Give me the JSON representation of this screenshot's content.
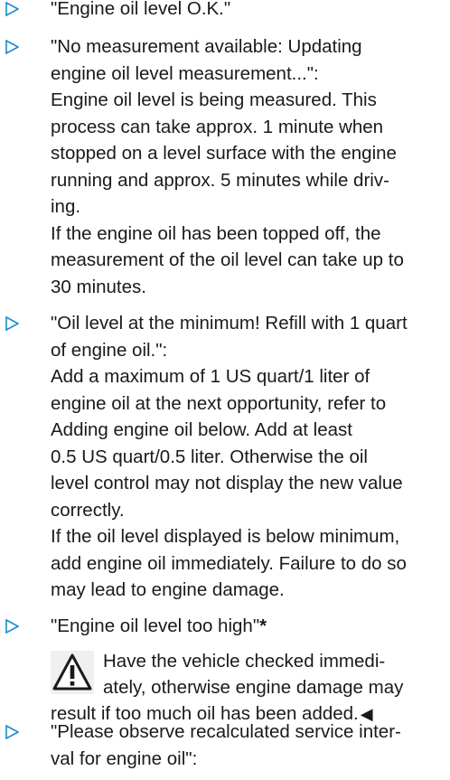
{
  "colors": {
    "bullet": "#1a8bd0",
    "text": "#1a1a1a",
    "warning_bg": "#f0f0f0"
  },
  "bullet_icon": "triangle-right-outline",
  "items": [
    {
      "lines": [
        "\"Engine oil level O.K.\""
      ]
    },
    {
      "lines": [
        "\"No measurement available: Updating",
        "engine oil level measurement...\":",
        "Engine oil level is being measured. This",
        "process can take approx. 1 minute when",
        "stopped on a level surface with the engine",
        "running and approx. 5 minutes while driv-",
        "ing.",
        "If the engine oil has been topped off, the",
        "measurement of the oil level can take up to",
        "30 minutes."
      ]
    },
    {
      "lines": [
        "\"Oil level at the minimum! Refill with 1 quart",
        "of engine oil.\":",
        "Add a maximum of 1 US quart/1 liter of",
        "engine oil at the next opportunity, refer to",
        "Adding engine oil below. Add at least",
        "0.5 US quart/0.5 liter. Otherwise the oil",
        "level control may not display the new value",
        "correctly.",
        "If the oil level displayed is below minimum,",
        "add engine oil immediately. Failure to do so",
        "may lead to engine damage."
      ]
    },
    {
      "label": "\"Engine oil level too high\"",
      "star": "*"
    },
    {
      "lines": [
        "\"Please observe recalculated service inter-",
        "val for engine oil\":"
      ]
    }
  ],
  "warning": {
    "icon": "warning-triangle-icon",
    "lines": [
      "Have the vehicle checked immedi-",
      "ately, otherwise engine damage may",
      "result if too much oil has been added."
    ],
    "end_mark": "◀"
  }
}
